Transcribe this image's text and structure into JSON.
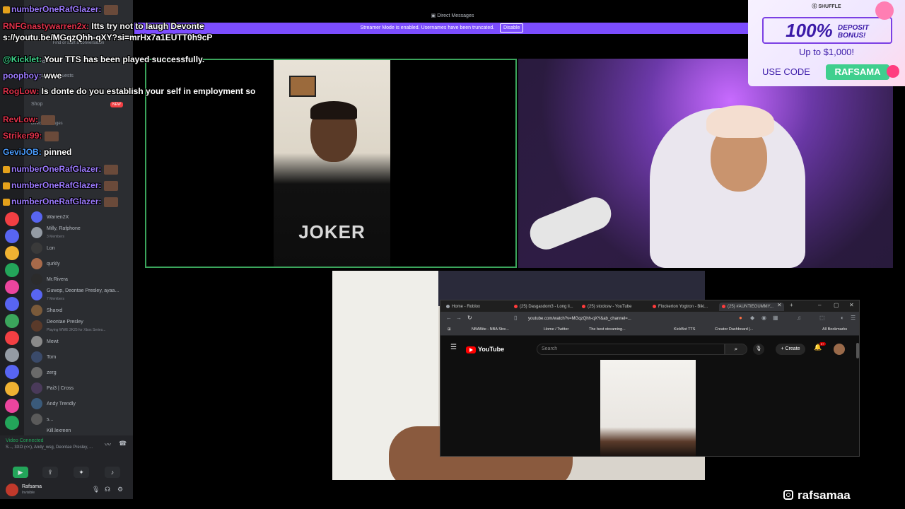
{
  "discord": {
    "top_title": "Direct Messages",
    "streamer_banner": "Streamer Mode is enabled. Usernames have been truncated.",
    "disable_label": "Disable",
    "search_placeholder": "Find or start a conversation",
    "nav_friends": "Friends",
    "nav_requests": "Message Requests",
    "nav_shop": "Shop",
    "shop_badge": "NEW",
    "dm_header": "Direct Messages",
    "dms": [
      {
        "name": "Warren2X",
        "sub": ""
      },
      {
        "name": "Milly, Rafphone",
        "sub": "3 Members"
      },
      {
        "name": "Lon",
        "sub": ""
      },
      {
        "name": "qurkly",
        "sub": ""
      },
      {
        "name": "Mr.Rivera",
        "sub": ""
      },
      {
        "name": "Guwop, Deontae Presley, ayaa...",
        "sub": "7 Members"
      },
      {
        "name": "Sharxd",
        "sub": ""
      },
      {
        "name": "Deontae Presley",
        "sub": "Playing WWE 2K25 for Xbox Series..."
      },
      {
        "name": "Mewt",
        "sub": ""
      },
      {
        "name": "Tom",
        "sub": ""
      },
      {
        "name": "zerg",
        "sub": ""
      },
      {
        "name": "Pai3 | Cross",
        "sub": ""
      },
      {
        "name": "Andy Trendly",
        "sub": ""
      },
      {
        "name": "s...",
        "sub": ""
      },
      {
        "name": "Kill.lexreen",
        "sub": ""
      }
    ],
    "voice_status": "Video Connected",
    "voice_members": "S..., 3XO (<<), Andy_wsg, Deontae Presley, ...",
    "user_name": "Rafsama",
    "user_status": "Invisible"
  },
  "chat": [
    {
      "user": "numberOneRafGlazer:",
      "msg": "",
      "color": "purple"
    },
    {
      "user": "RNFGnastywarren2x:",
      "msg": "Itts try not to laugh Devonte",
      "color": "red"
    },
    {
      "user": "",
      "msg": "s://youtu.be/MGqzQhh-qXY?si=mrHx7a1EUTT0h9cP",
      "color": "purple"
    },
    {
      "user": "@Kicklet:",
      "msg": "Your TTS has been played successfully.",
      "color": "green"
    },
    {
      "user": "poopboy:",
      "msg": "wwe",
      "color": "purple"
    },
    {
      "user": "RogLow:",
      "msg": "Is donte do you establish your self in employment so",
      "color": "red"
    },
    {
      "user": "RevLow:",
      "msg": "",
      "color": "red"
    },
    {
      "user": "Striker99:",
      "msg": "",
      "color": "red"
    },
    {
      "user": "GeviJOB:",
      "msg": "pinned",
      "color": "blue"
    },
    {
      "user": "numberOneRafGlazer:",
      "msg": "",
      "color": "purple"
    },
    {
      "user": "numberOneRafGlazer:",
      "msg": "",
      "color": "purple"
    },
    {
      "user": "numberOneRafGlazer:",
      "msg": "",
      "color": "purple"
    }
  ],
  "tiles": {
    "shirt_text": "JOKER"
  },
  "browser": {
    "tabs": [
      "Home - Roblox",
      "(25) Dasgasdom3 - Long li...",
      "(25) stocksw - YouTube",
      "Flockerton Yogtron - Biki...",
      "(25) #AUNTIEGUMMY..."
    ],
    "url": "youtube.com/watch?v=MGqzQhh-qXY&ab_channel=...",
    "bookmarks": [
      "NBABite - NBA Stre...",
      "Home / Twitter",
      "The best streaming...",
      "KickBot TTS",
      "Creator Dashboard |...",
      "All Bookmarks"
    ],
    "yt_logo": "YouTube",
    "yt_search_placeholder": "Search",
    "yt_create": "Create",
    "yt_notif_count": "9+"
  },
  "ad": {
    "brand": "SHUFFLE",
    "headline": "100%",
    "headline_line1": "DEPOSIT",
    "headline_line2": "BONUS!",
    "sub": "Up to $1,000!",
    "use_code": "USE CODE",
    "code": "RAFSAMA"
  },
  "overlay": {
    "handle": "rafsamaa"
  },
  "colors": {
    "accent": "#7c4dff",
    "speaking_border": "#3ba55c",
    "ad_code": "#3fcf8e"
  }
}
